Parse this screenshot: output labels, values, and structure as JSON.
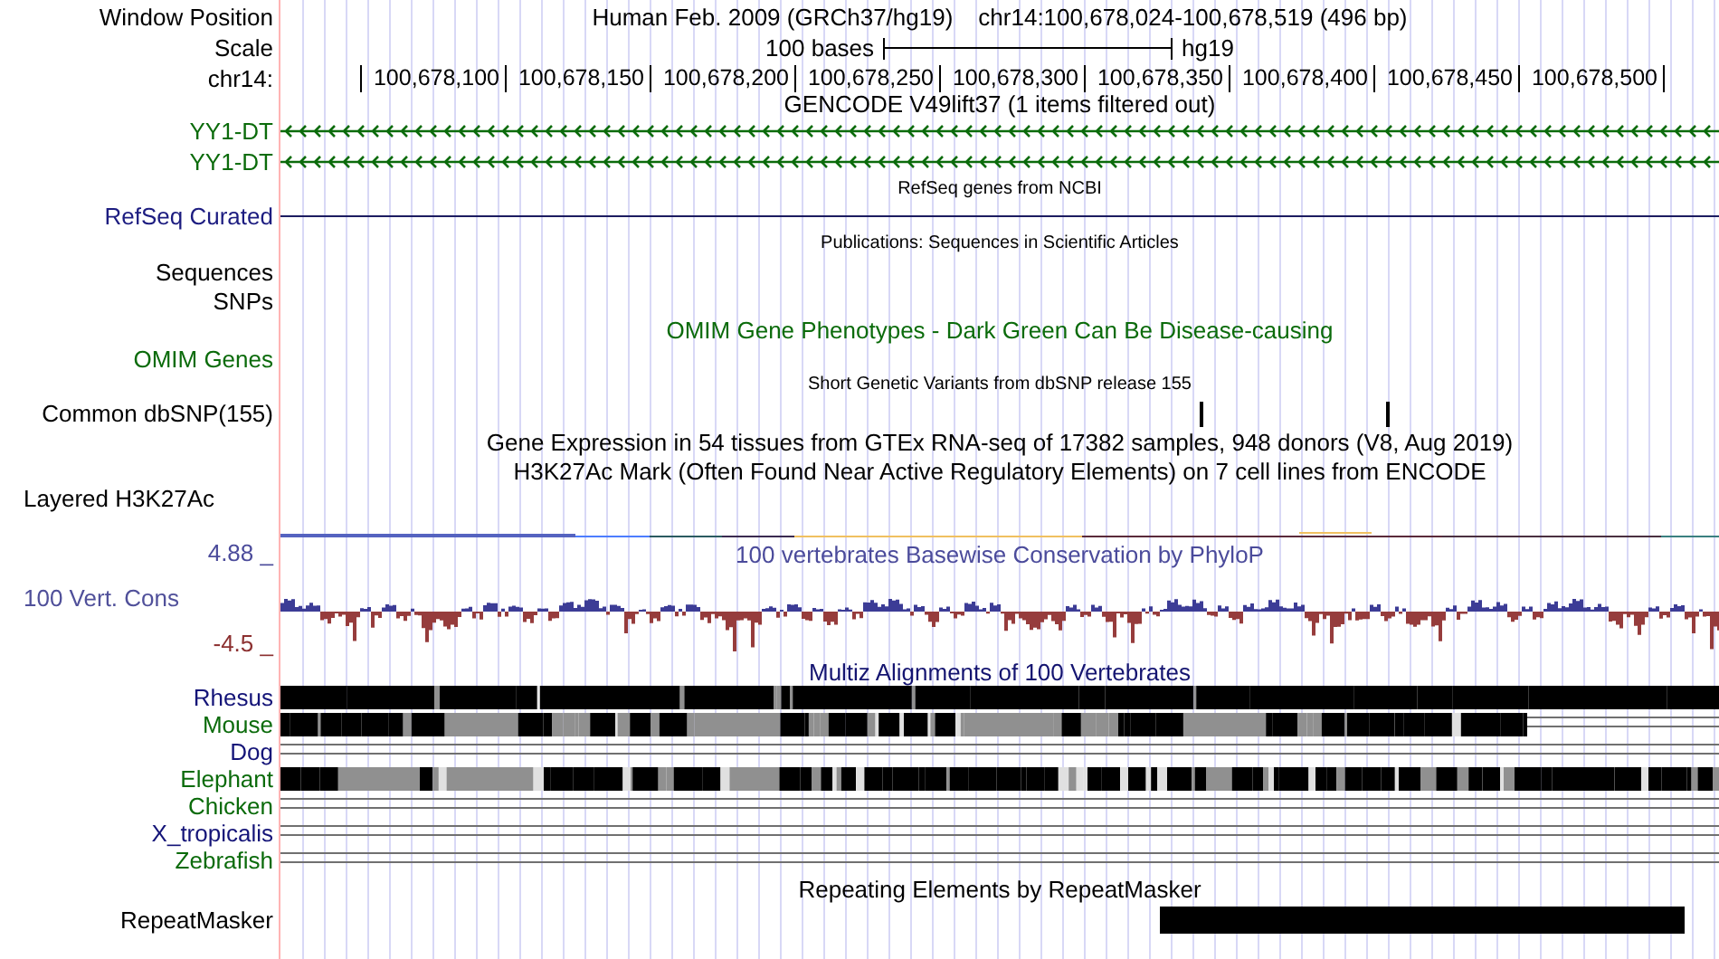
{
  "window_position": {
    "label": "Window Position",
    "assembly": "Human Feb. 2009 (GRCh37/hg19)",
    "position": "chr14:100,678,024-100,678,519 (496 bp)"
  },
  "scale": {
    "label": "Scale",
    "bar_label": "100 bases",
    "assembly": "hg19"
  },
  "ruler": {
    "label": "chr14:",
    "ticks": [
      "100,678,100",
      "100,678,150",
      "100,678,200",
      "100,678,250",
      "100,678,300",
      "100,678,350",
      "100,678,400",
      "100,678,450",
      "100,678,500"
    ]
  },
  "gencode": {
    "title": "GENCODE V49lift37 (1 items filtered out)",
    "transcripts": [
      {
        "name": "YY1-DT"
      },
      {
        "name": "YY1-DT"
      }
    ]
  },
  "refseq": {
    "title": "RefSeq genes from NCBI",
    "label": "RefSeq Curated"
  },
  "publications": {
    "title": "Publications: Sequences in Scientific Articles",
    "labels": [
      "Sequences",
      "SNPs"
    ]
  },
  "omim": {
    "title": "OMIM Gene Phenotypes - Dark Green Can Be Disease-causing",
    "label": "OMIM Genes"
  },
  "dbsnp": {
    "title": "Short Genetic Variants from dbSNP release 155",
    "label": "Common dbSNP(155)"
  },
  "gtex": {
    "title": "Gene Expression in 54 tissues from GTEx RNA-seq of 17382 samples, 948 donors (V8, Aug 2019)"
  },
  "h3k27ac": {
    "title": "H3K27Ac Mark (Often Found Near Active Regulatory Elements) on 7 cell lines from ENCODE",
    "label": "Layered H3K27Ac"
  },
  "phylop": {
    "title": "100 vertebrates Basewise Conservation by PhyloP",
    "label": "100 Vert. Cons",
    "max_label": "4.88 _",
    "min_label": "-4.5 _"
  },
  "multiz": {
    "title": "Multiz Alignments of 100 Vertebrates",
    "species": [
      {
        "name": "Rhesus",
        "color": "#141478",
        "kind": "blocks"
      },
      {
        "name": "Mouse",
        "color": "#0b6b0b",
        "kind": "blocks"
      },
      {
        "name": "Dog",
        "color": "#141478",
        "kind": "lines"
      },
      {
        "name": "Elephant",
        "color": "#0b6b0b",
        "kind": "blocks"
      },
      {
        "name": "Chicken",
        "color": "#0b6b0b",
        "kind": "lines"
      },
      {
        "name": "X_tropicalis",
        "color": "#141478",
        "kind": "lines"
      },
      {
        "name": "Zebrafish",
        "color": "#0b6b0b",
        "kind": "lines"
      }
    ]
  },
  "repeatmasker": {
    "title": "Repeating Elements by RepeatMasker",
    "label": "RepeatMasker"
  }
}
